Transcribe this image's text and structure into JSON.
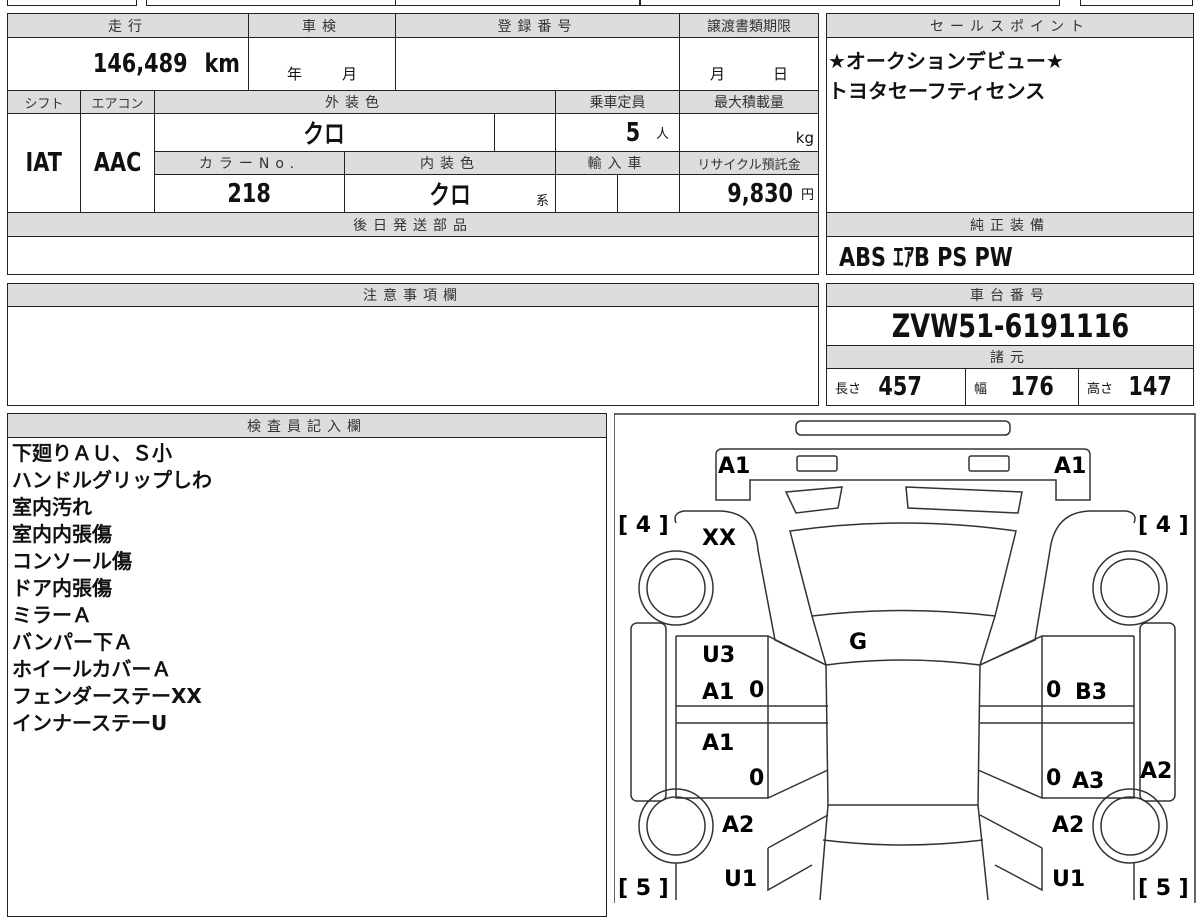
{
  "vehicle": {
    "mileage_label": "走行",
    "mileage": "146,489",
    "mileage_unit": "km",
    "inspection_label": "車検",
    "inspection_year": "年",
    "inspection_month": "月",
    "registration_label": "登録番号",
    "doc_deadline_label": "譲渡書類期限",
    "doc_month": "月",
    "doc_day": "日",
    "shift_label": "シフト",
    "ac_label": "エアコン",
    "exterior_label": "外装色",
    "capacity_label": "乗車定員",
    "max_load_label": "最大積載量",
    "shift": "IAT",
    "ac": "AAC",
    "exterior": "クロ",
    "capacity": "5",
    "capacity_unit": "人",
    "load_unit": "kg",
    "color_no_label": "カラーNo.",
    "interior_label": "内装色",
    "import_label": "輸入車",
    "recycle_label": "リサイクル預託金",
    "color_no": "218",
    "interior": "クロ",
    "interior_suffix": "系",
    "recycle": "9,830",
    "recycle_unit": "円",
    "later_parts_label": "後日発送部品"
  },
  "sales_point": {
    "label": "セールスポイント",
    "lines": [
      "★オークションデビュー★",
      "トヨタセーフティセンス"
    ]
  },
  "equipment": {
    "label": "純正装備",
    "value": "ABS ｴｱB PS PW"
  },
  "notes": {
    "label": "注意事項欄"
  },
  "chassis": {
    "label": "車台番号",
    "value": "ZVW51-6191116",
    "spec_label": "諸元",
    "length_label": "長さ",
    "length": "457",
    "width_label": "幅",
    "width": "176",
    "height_label": "高さ",
    "height": "147"
  },
  "inspector": {
    "label": "検査員記入欄",
    "lines": [
      "下廻りＡＵ、Ｓ小",
      "ハンドルグリップしわ",
      "室内汚れ",
      "室内内張傷",
      "コンソール傷",
      "ドア内張傷",
      "ミラーＡ",
      "バンパー下Ａ",
      "ホイールカバーＡ",
      "フェンダーステーXX",
      "インナーステーU"
    ]
  },
  "diagram": {
    "marks": {
      "front_left": "A1",
      "front_right": "A1",
      "tire_fl": "[ 4 ]",
      "tire_fr": "[ 4 ]",
      "tire_rl": "[ 5 ]",
      "tire_rr": "[ 5 ]",
      "fender_fl": "XX",
      "windshield": "G",
      "door_fl1": "U3",
      "door_fl2": "A1",
      "door_rl": "A1",
      "door_fr": "B3",
      "door_rr": "A3",
      "sill_r": "A2",
      "quarter_l": "A2",
      "quarter_r": "A2",
      "rear_l": "U1",
      "rear_r": "U1",
      "z1": "0",
      "z2": "0",
      "z3": "0",
      "z4": "0"
    }
  }
}
